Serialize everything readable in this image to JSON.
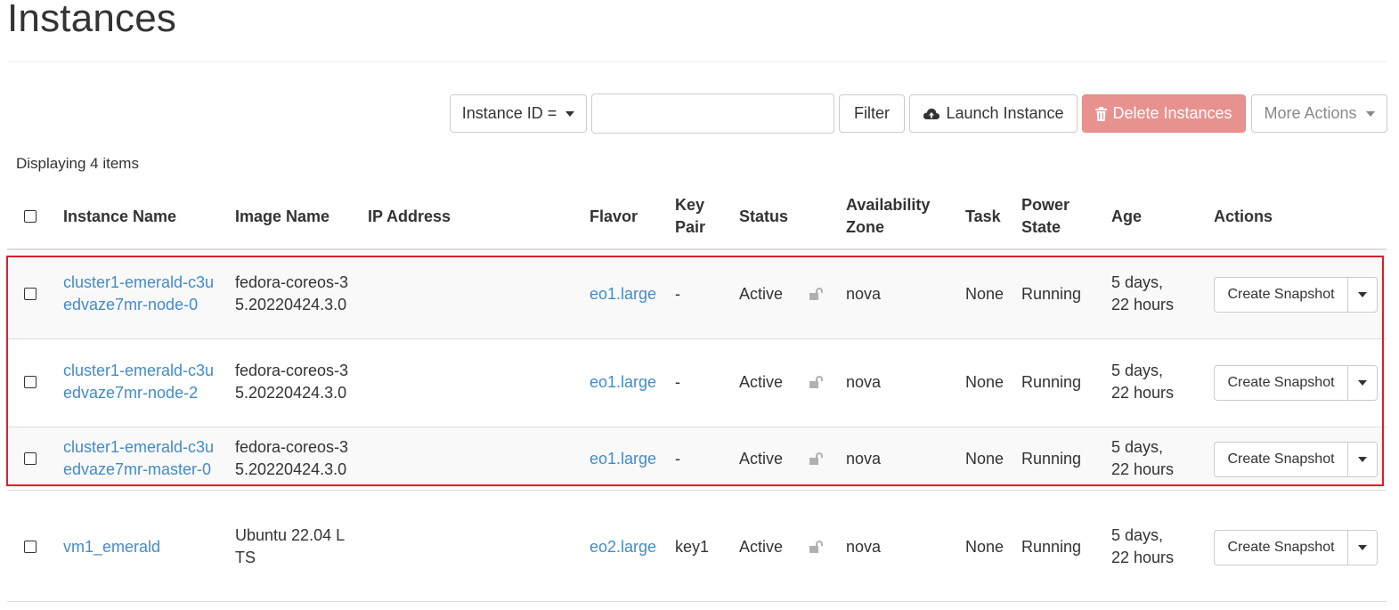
{
  "page": {
    "title": "Instances"
  },
  "toolbar": {
    "filter_field": "Instance ID =",
    "filter_input_value": "",
    "filter_label": "Filter",
    "launch_label": "Launch Instance",
    "delete_label": "Delete Instances",
    "more_label": "More Actions"
  },
  "table": {
    "display_count": "Displaying 4 items",
    "headers": {
      "instance_name": "Instance Name",
      "image_name": "Image Name",
      "ip_address": "IP Address",
      "flavor": "Flavor",
      "key_pair_1": "Key",
      "key_pair_2": "Pair",
      "status": "Status",
      "az_1": "Availability",
      "az_2": "Zone",
      "task": "Task",
      "power_1": "Power",
      "power_2": "State",
      "age": "Age",
      "actions": "Actions"
    },
    "rows": [
      {
        "name_1": "cluster1-emerald-c3u",
        "name_2": "edvaze7mr-node-0",
        "image_1": "fedora-coreos-3",
        "image_2": "5.20220424.3.0",
        "ip": "",
        "flavor": "eo1.large",
        "key_pair": "-",
        "status": "Active",
        "az": "nova",
        "task": "None",
        "power": "Running",
        "age_1": "5 days,",
        "age_2": "22 hours",
        "action": "Create Snapshot"
      },
      {
        "name_1": "cluster1-emerald-c3u",
        "name_2": "edvaze7mr-node-2",
        "image_1": "fedora-coreos-3",
        "image_2": "5.20220424.3.0",
        "ip": "",
        "flavor": "eo1.large",
        "key_pair": "-",
        "status": "Active",
        "az": "nova",
        "task": "None",
        "power": "Running",
        "age_1": "5 days,",
        "age_2": "22 hours",
        "action": "Create Snapshot"
      },
      {
        "name_1": "cluster1-emerald-c3u",
        "name_2": "edvaze7mr-master-0",
        "image_1": "fedora-coreos-3",
        "image_2": "5.20220424.3.0",
        "ip": "",
        "flavor": "eo1.large",
        "key_pair": "-",
        "status": "Active",
        "az": "nova",
        "task": "None",
        "power": "Running",
        "age_1": "5 days,",
        "age_2": "22 hours",
        "action": "Create Snapshot"
      },
      {
        "name_1": "vm1_emerald",
        "name_2": "",
        "image_1": "Ubuntu 22.04 L",
        "image_2": "TS",
        "ip": "",
        "flavor": "eo2.large",
        "key_pair": "key1",
        "status": "Active",
        "az": "nova",
        "task": "None",
        "power": "Running",
        "age_1": "5 days,",
        "age_2": "22 hours",
        "action": "Create Snapshot"
      }
    ]
  },
  "colors": {
    "link": "#428bca",
    "danger": "#e8928f",
    "highlight": "#d9202a"
  }
}
